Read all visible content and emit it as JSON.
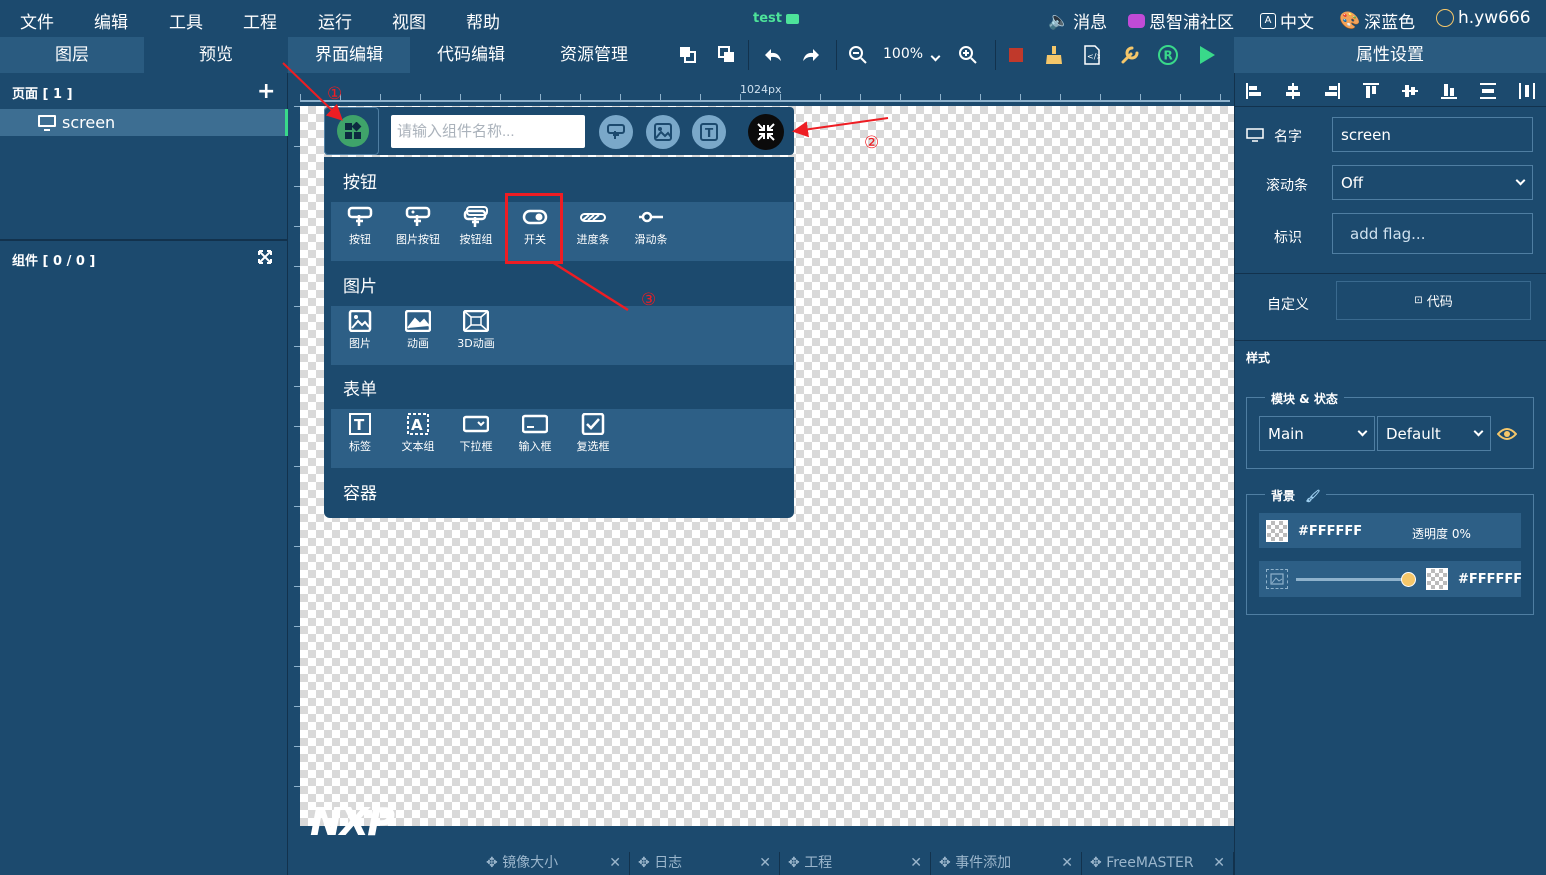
{
  "menu": [
    "文件",
    "编辑",
    "工具",
    "工程",
    "运行",
    "视图",
    "帮助"
  ],
  "project_name": "test",
  "topright": {
    "messages": "消息",
    "community": "恩智浦社区",
    "language": "中文",
    "theme": "深蓝色",
    "user": "h.yw666"
  },
  "left_tabs": [
    "图层",
    "预览"
  ],
  "edit_tabs": [
    "界面编辑",
    "代码编辑",
    "资源管理"
  ],
  "toolbar": {
    "zoom": "100%"
  },
  "layers": {
    "pages_head": "页面 [ 1 ]",
    "add": "+",
    "page_name": "screen",
    "components_head": "组件 [ 0 / 0 ]"
  },
  "ruler": {
    "width_label": "1024px"
  },
  "picker": {
    "search_placeholder": "请输入组件名称...",
    "categories": [
      {
        "title": "按钮",
        "items": [
          "按钮",
          "图片按钮",
          "按钮组",
          "开关",
          "进度条",
          "滑动条"
        ]
      },
      {
        "title": "图片",
        "items": [
          "图片",
          "动画",
          "3D动画"
        ]
      },
      {
        "title": "表单",
        "items": [
          "标签",
          "文本组",
          "下拉框",
          "输入框",
          "复选框"
        ]
      },
      {
        "title": "容器",
        "items": []
      }
    ]
  },
  "annotations": [
    "①",
    "②",
    "③"
  ],
  "logo": "NXP",
  "bottom_tabs": [
    "镜像大小",
    "日志",
    "工程",
    "事件添加",
    "FreeMASTER"
  ],
  "props": {
    "title": "属性设置",
    "name_label": "名字",
    "name_value": "screen",
    "scroll_label": "滚动条",
    "scroll_value": "Off",
    "flag_label": "标识",
    "flag_placeholder": "add flag...",
    "custom_label": "自定义",
    "code_button": "代码",
    "style_head": "样式",
    "module_state_legend": "模块 & 状态",
    "module_value": "Main",
    "state_value": "Default",
    "background_legend": "背景",
    "bg_color": "#FFFFFF",
    "opacity_label": "透明度 0%",
    "bg_color2": "#FFFFFF",
    "slider_value": 1.0
  },
  "colors": {
    "panel": "#1c4a6e",
    "accent_green": "#4de39a",
    "annotation_red": "#ee1d23",
    "slider_knob": "#f5c76a"
  }
}
